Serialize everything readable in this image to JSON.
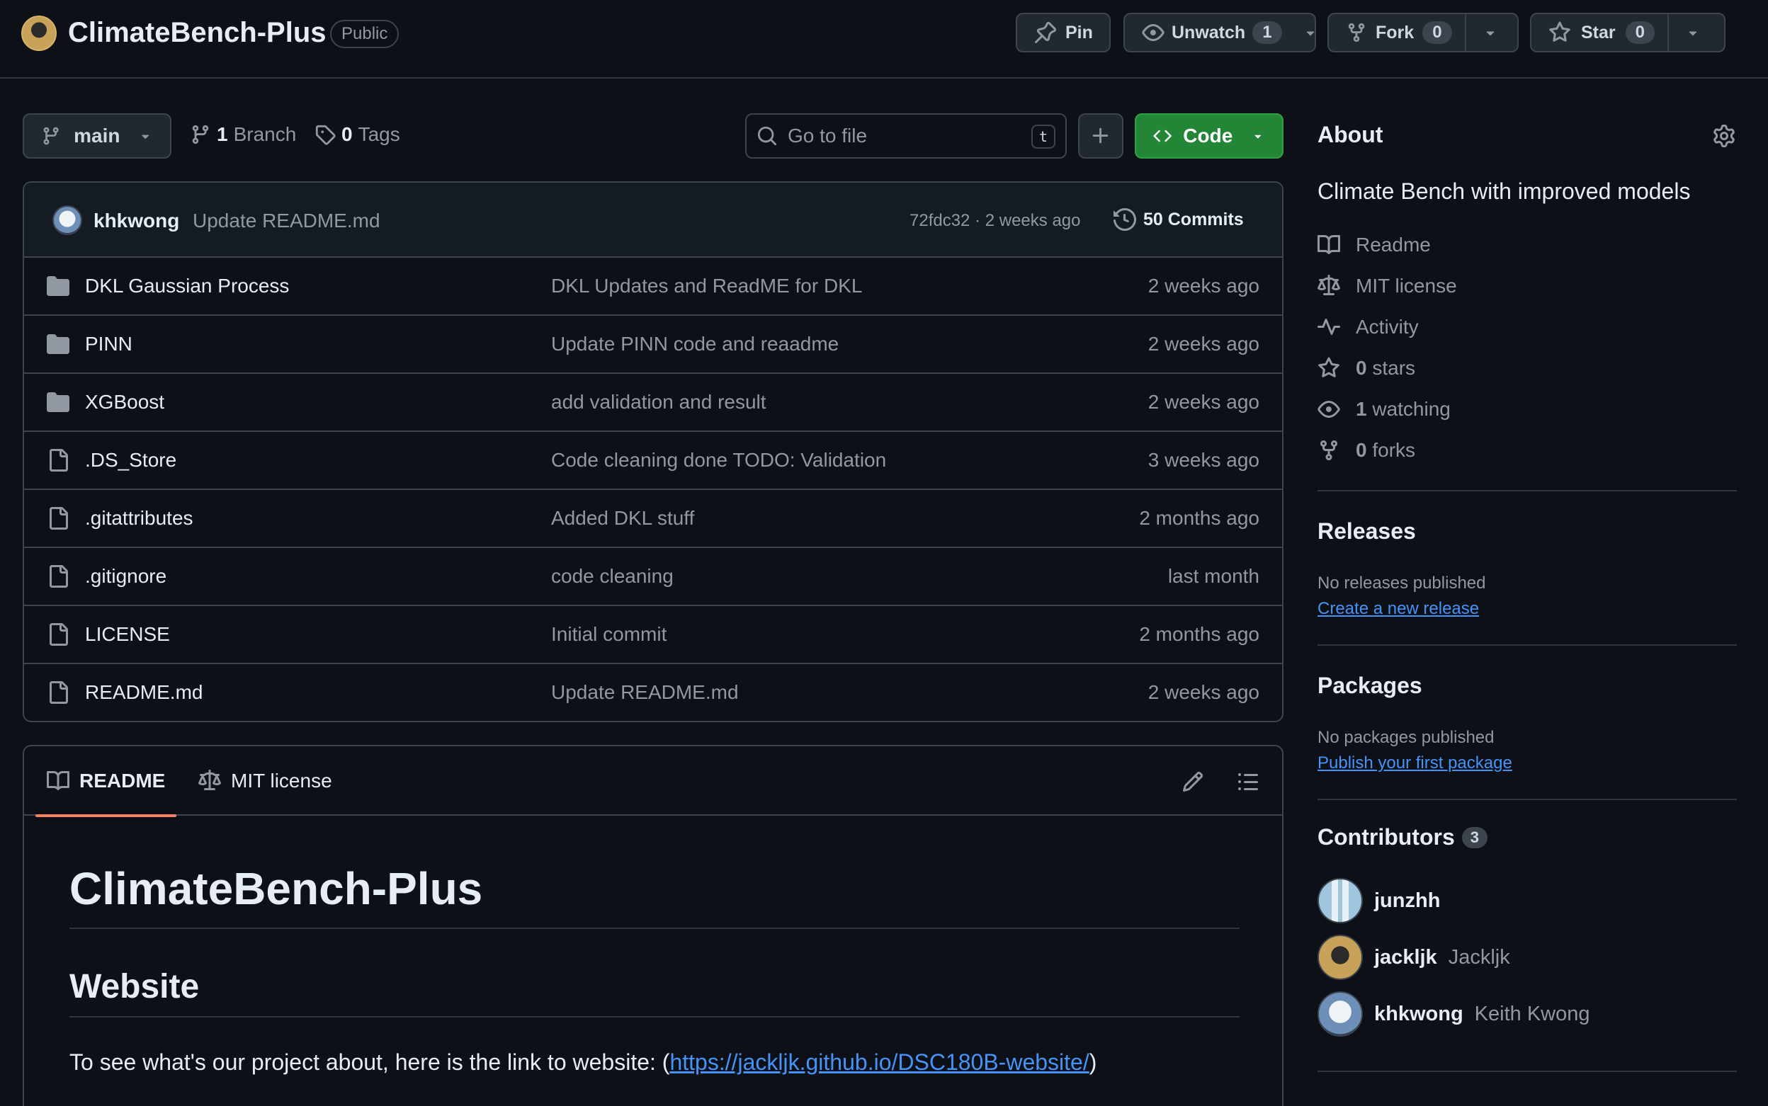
{
  "repo": {
    "name": "ClimateBench-Plus",
    "visibility": "Public"
  },
  "header_actions": {
    "pin": "Pin",
    "unwatch": "Unwatch",
    "watch_count": "1",
    "fork": "Fork",
    "fork_count": "0",
    "star": "Star",
    "star_count": "0"
  },
  "toolbar": {
    "branch": "main",
    "branches_count": "1",
    "branches_label": "Branch",
    "tags_count": "0",
    "tags_label": "Tags",
    "search_placeholder": "Go to file",
    "search_shortcut": "t",
    "code_label": "Code"
  },
  "latest_commit": {
    "author": "khkwong",
    "message": "Update README.md",
    "sha_time": "72fdc32 · 2 weeks ago",
    "commits_label": "50 Commits"
  },
  "files": [
    {
      "type": "dir",
      "name": "DKL Gaussian Process",
      "message": "DKL Updates and ReadME for DKL",
      "date": "2 weeks ago"
    },
    {
      "type": "dir",
      "name": "PINN",
      "message": "Update PINN code and reaadme",
      "date": "2 weeks ago"
    },
    {
      "type": "dir",
      "name": "XGBoost",
      "message": "add validation and result",
      "date": "2 weeks ago"
    },
    {
      "type": "file",
      "name": ".DS_Store",
      "message": "Code cleaning done TODO: Validation",
      "date": "3 weeks ago"
    },
    {
      "type": "file",
      "name": ".gitattributes",
      "message": "Added DKL stuff",
      "date": "2 months ago"
    },
    {
      "type": "file",
      "name": ".gitignore",
      "message": "code cleaning",
      "date": "last month"
    },
    {
      "type": "file",
      "name": "LICENSE",
      "message": "Initial commit",
      "date": "2 months ago"
    },
    {
      "type": "file",
      "name": "README.md",
      "message": "Update README.md",
      "date": "2 weeks ago"
    }
  ],
  "readme": {
    "tab_readme": "README",
    "tab_license": "MIT license",
    "h1": "ClimateBench-Plus",
    "h2": "Website",
    "para_prefix": "To see what's our project about, here is the link to website: (",
    "para_link": "https://jackljk.github.io/DSC180B-website/",
    "para_suffix": ")"
  },
  "about": {
    "heading": "About",
    "description": "Climate Bench with improved models",
    "readme": "Readme",
    "license": "MIT license",
    "activity": "Activity",
    "stars_count": "0",
    "stars_label": "stars",
    "watching_count": "1",
    "watching_label": "watching",
    "forks_count": "0",
    "forks_label": "forks"
  },
  "releases": {
    "heading": "Releases",
    "none": "No releases published",
    "link": "Create a new release"
  },
  "packages": {
    "heading": "Packages",
    "none": "No packages published",
    "link": "Publish your first package"
  },
  "contributors": {
    "heading": "Contributors",
    "count": "3",
    "people": [
      {
        "login": "junzhh",
        "name": ""
      },
      {
        "login": "jackljk",
        "name": "Jackljk"
      },
      {
        "login": "khkwong",
        "name": "Keith Kwong"
      }
    ]
  },
  "colors": {
    "background": "#0d1117",
    "border": "#3d444d",
    "accent_green": "#238636",
    "link_blue": "#4493f8",
    "tab_underline": "#f78166"
  }
}
